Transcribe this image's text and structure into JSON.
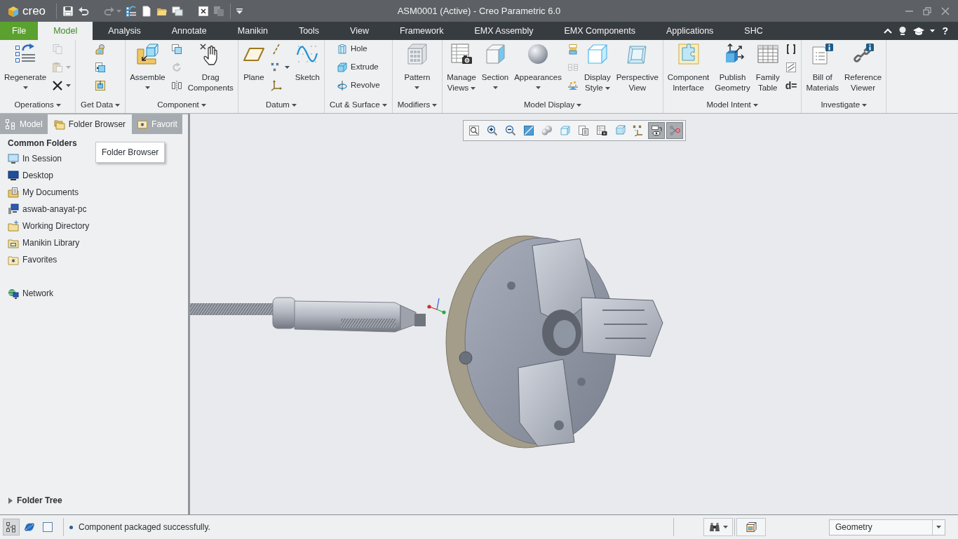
{
  "window": {
    "logo": "creo",
    "title": "ASM0001 (Active) - Creo Parametric 6.0"
  },
  "quick_access": [
    {
      "disabled": false,
      "dropdown": false
    },
    {
      "disabled": false,
      "dropdown": false
    },
    {
      "disabled": true,
      "dropdown": true
    },
    {
      "disabled": false,
      "dropdown": false
    },
    {
      "disabled": false,
      "dropdown": false
    },
    {
      "disabled": false,
      "dropdown": false
    },
    {
      "disabled": false,
      "dropdown": false
    },
    {
      "disabled": false,
      "dropdown": false
    },
    {
      "disabled": true,
      "dropdown": false
    }
  ],
  "menu_tabs": [
    {
      "label": "File",
      "kind": "file",
      "selected": false
    },
    {
      "label": "Model",
      "kind": "tab",
      "selected": true
    },
    {
      "label": "Analysis",
      "kind": "tab",
      "selected": false
    },
    {
      "label": "Annotate",
      "kind": "tab",
      "selected": false
    },
    {
      "label": "Manikin",
      "kind": "tab",
      "selected": false
    },
    {
      "label": "Tools",
      "kind": "tab",
      "selected": false
    },
    {
      "label": "View",
      "kind": "tab",
      "selected": false
    },
    {
      "label": "Framework",
      "kind": "tab",
      "selected": false
    },
    {
      "label": "EMX Assembly",
      "kind": "tab",
      "selected": false
    },
    {
      "label": "EMX Components",
      "kind": "tab",
      "selected": false
    },
    {
      "label": "Applications",
      "kind": "tab",
      "selected": false
    },
    {
      "label": "SHC",
      "kind": "tab",
      "selected": false
    }
  ],
  "help": "?",
  "ribbon_groups": [
    {
      "label": "Operations",
      "dropdown": true,
      "items": [
        {
          "kind": "large",
          "label": "Regenerate",
          "dropdown": true
        },
        {
          "kind": "stack",
          "rows": [
            {
              "disabled": true,
              "dropdown": false
            },
            {
              "disabled": true,
              "dropdown": true
            },
            {
              "disabled": false,
              "dropdown": true
            }
          ]
        }
      ]
    },
    {
      "label": "Get Data",
      "dropdown": true,
      "items": [
        {
          "kind": "stack",
          "rows": [
            {
              "disabled": false,
              "dropdown": false
            },
            {
              "disabled": false,
              "dropdown": false
            },
            {
              "disabled": false,
              "dropdown": false
            }
          ]
        }
      ]
    },
    {
      "label": "Component",
      "dropdown": true,
      "items": [
        {
          "kind": "large",
          "label": "Assemble",
          "dropdown": true
        },
        {
          "kind": "stack",
          "rows": [
            {
              "disabled": false,
              "dropdown": false
            },
            {
              "disabled": true,
              "dropdown": false
            },
            {
              "disabled": false,
              "dropdown": false
            }
          ]
        },
        {
          "kind": "large",
          "label": "Drag Components",
          "dropdown": false
        }
      ]
    },
    {
      "label": "Datum",
      "dropdown": true,
      "items": [
        {
          "kind": "large",
          "label": "Plane",
          "dropdown": false
        },
        {
          "kind": "stack",
          "rows": [
            {
              "disabled": false,
              "dropdown": false
            },
            {
              "disabled": false,
              "dropdown": true
            },
            {
              "disabled": false,
              "dropdown": false
            }
          ]
        },
        {
          "kind": "large",
          "label": "Sketch",
          "dropdown": false
        }
      ]
    },
    {
      "label": "Cut & Surface",
      "dropdown": true,
      "items": [
        {
          "kind": "stack",
          "rows": [
            {
              "label": "Hole",
              "disabled": false,
              "dropdown": false
            },
            {
              "label": "Extrude",
              "disabled": false,
              "dropdown": false
            },
            {
              "label": "Revolve",
              "disabled": false,
              "dropdown": false
            }
          ]
        }
      ]
    },
    {
      "label": "Modifiers",
      "dropdown": true,
      "items": [
        {
          "kind": "large",
          "label": "Pattern",
          "dropdown": true
        }
      ]
    },
    {
      "label": "Model Display",
      "dropdown": true,
      "items": [
        {
          "kind": "large",
          "label": "Manage Views",
          "dropdown": true
        },
        {
          "kind": "large",
          "label": "Section",
          "dropdown": true
        },
        {
          "kind": "large",
          "label": "Appearances",
          "dropdown": true
        },
        {
          "kind": "stack",
          "rows": [
            {
              "disabled": false,
              "dropdown": false
            },
            {
              "disabled": true,
              "dropdown": false
            },
            {
              "disabled": false,
              "dropdown": false
            }
          ]
        },
        {
          "kind": "large",
          "label": "Display Style",
          "dropdown": true
        },
        {
          "kind": "large",
          "label": "Perspective View",
          "dropdown": false
        }
      ]
    },
    {
      "label": "Model Intent",
      "dropdown": true,
      "items": [
        {
          "kind": "large",
          "label": "Component Interface",
          "dropdown": false
        },
        {
          "kind": "large",
          "label": "Publish Geometry",
          "dropdown": false
        },
        {
          "kind": "large",
          "label": "Family Table",
          "dropdown": false
        },
        {
          "kind": "stack",
          "rows": [
            {
              "disabled": false,
              "dropdown": false
            },
            {
              "disabled": false,
              "dropdown": false
            },
            {
              "glyph": "d=",
              "disabled": false,
              "dropdown": false
            }
          ]
        }
      ]
    },
    {
      "label": "Investigate",
      "dropdown": true,
      "items": [
        {
          "kind": "large",
          "label": "Bill of Materials",
          "dropdown": false
        },
        {
          "kind": "large",
          "label": "Reference Viewer",
          "dropdown": false
        }
      ]
    }
  ],
  "left_panel": {
    "tabs": [
      {
        "label": "Model",
        "selected": false
      },
      {
        "label": "Folder Browser",
        "selected": true
      },
      {
        "label": "Favorit",
        "selected": false
      }
    ],
    "tooltip": "Folder Browser",
    "heading": "Common Folders",
    "folders": [
      {
        "label": "In Session",
        "selected": false
      },
      {
        "label": "Desktop",
        "selected": false
      },
      {
        "label": "My Documents",
        "selected": false
      },
      {
        "label": "aswab-anayat-pc",
        "selected": false
      },
      {
        "label": "Working Directory",
        "selected": false
      },
      {
        "label": "Manikin Library",
        "selected": false
      },
      {
        "label": "Favorites",
        "selected": false
      }
    ],
    "network": {
      "label": "Network",
      "selected": false
    },
    "folder_tree": {
      "label": "Folder Tree",
      "expanded": false
    }
  },
  "view_toolbar": [
    {
      "pressed": false
    },
    {
      "pressed": false
    },
    {
      "pressed": false
    },
    {
      "pressed": false
    },
    {
      "pressed": false
    },
    {
      "pressed": false
    },
    {
      "pressed": false
    },
    {
      "pressed": false
    },
    {
      "pressed": false
    },
    {
      "pressed": false
    },
    {
      "pressed": true
    },
    {
      "pressed": true
    }
  ],
  "status_bar": {
    "view_buttons": [
      {
        "pressed": true
      },
      {
        "pressed": false
      },
      {
        "pressed": false
      }
    ],
    "message": "Component packaged successfully.",
    "filter": {
      "value": "Geometry"
    }
  }
}
